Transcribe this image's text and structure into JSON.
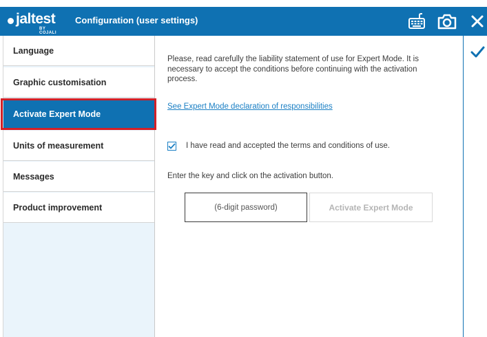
{
  "header": {
    "logo_text": "jaltest",
    "logo_sub": "BY COJALI",
    "title": "Configuration (user settings)",
    "icons": [
      "keyboard-icon",
      "camera-icon",
      "close-icon"
    ]
  },
  "sidebar": {
    "items": [
      {
        "label": "Language",
        "active": false
      },
      {
        "label": "Graphic customisation",
        "active": false
      },
      {
        "label": "Activate Expert Mode",
        "active": true
      },
      {
        "label": "Units of measurement",
        "active": false
      },
      {
        "label": "Messages",
        "active": false
      },
      {
        "label": "Product improvement",
        "active": false
      }
    ]
  },
  "main": {
    "statement": "Please, read carefully the liability statement of use for Expert Mode. It is necessary to accept the conditions before continuing with the activation process.",
    "declaration_link": "See Expert Mode declaration of responsibilities",
    "terms_label": "I have read and accepted the terms and conditions of use.",
    "terms_checked": true,
    "instruction": "Enter the key and click on the activation button.",
    "password_placeholder": "(6-digit password)",
    "activate_label": "Activate Expert Mode"
  },
  "actions": {
    "confirm_icon": "checkmark-icon"
  },
  "colors": {
    "brand": "#0f71b2",
    "sidebar_bg": "#eaf4fb",
    "link": "#1a7fc4",
    "highlight": "#d32027",
    "disabled_text": "#b5b5b5"
  }
}
